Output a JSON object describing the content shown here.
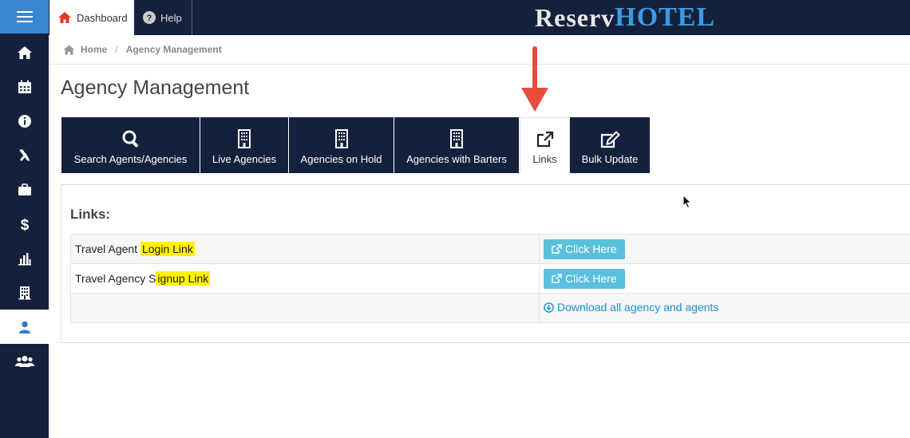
{
  "topbar": {
    "dashboard_label": "Dashboard",
    "help_label": "Help",
    "logo_part1": "Reserv",
    "logo_part2": "HOTEL"
  },
  "sidebar": {
    "items": [
      {
        "icon": "home-icon"
      },
      {
        "icon": "calendar-icon"
      },
      {
        "icon": "info-icon"
      },
      {
        "icon": "tools-icon"
      },
      {
        "icon": "briefcase-icon"
      },
      {
        "icon": "dollar-icon"
      },
      {
        "icon": "bar-chart-icon"
      },
      {
        "icon": "building-icon"
      },
      {
        "icon": "user-icon",
        "active": true
      },
      {
        "icon": "users-icon"
      }
    ]
  },
  "breadcrumb": {
    "home": "Home",
    "current": "Agency Management"
  },
  "page": {
    "title": "Agency Management"
  },
  "tabs": [
    {
      "label": "Search Agents/Agencies",
      "icon": "search-icon"
    },
    {
      "label": "Live Agencies",
      "icon": "building-icon"
    },
    {
      "label": "Agencies on Hold",
      "icon": "building-icon"
    },
    {
      "label": "Agencies with Barters",
      "icon": "building-icon"
    },
    {
      "label": "Links",
      "icon": "external-link-icon",
      "active": true
    },
    {
      "label": "Bulk Update",
      "icon": "edit-icon"
    }
  ],
  "links_panel": {
    "title": "Links:",
    "rows": [
      {
        "label_plain": "Travel Agent ",
        "label_highlight": "Login Link",
        "action": "Click Here"
      },
      {
        "label_plain": "Travel Agency S",
        "label_highlight": "ignup Link",
        "action": "Click Here"
      }
    ],
    "download_label": "Download all agency and agents"
  },
  "colors": {
    "navy": "#14213d",
    "accent_blue": "#3a86d1",
    "button_info": "#5bc0de",
    "highlight": "#fff200",
    "arrow_red": "#e74c3c"
  }
}
